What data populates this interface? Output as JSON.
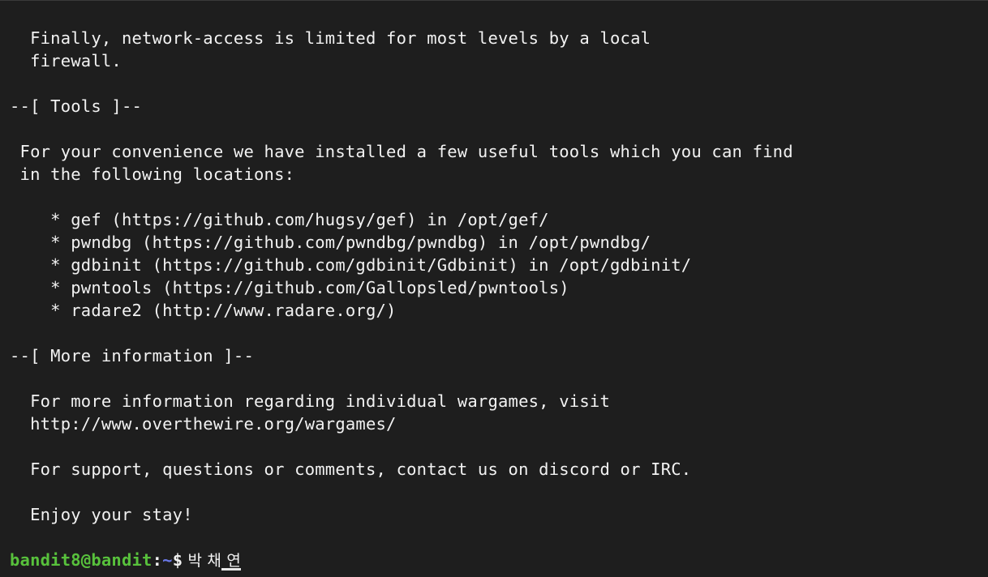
{
  "terminal": {
    "lines": [
      "  Finally, network-access is limited for most levels by a local",
      "  firewall.",
      "",
      "--[ Tools ]--",
      "",
      " For your convenience we have installed a few useful tools which you can find",
      " in the following locations:",
      "",
      "    * gef (https://github.com/hugsy/gef) in /opt/gef/",
      "    * pwndbg (https://github.com/pwndbg/pwndbg) in /opt/pwndbg/",
      "    * gdbinit (https://github.com/gdbinit/Gdbinit) in /opt/gdbinit/",
      "    * pwntools (https://github.com/Gallopsled/pwntools)",
      "    * radare2 (http://www.radare.org/)",
      "",
      "--[ More information ]--",
      "",
      "  For more information regarding individual wargames, visit",
      "  http://www.overthewire.org/wargames/",
      "",
      "  For support, questions or comments, contact us on discord or IRC.",
      "",
      "  Enjoy your stay!",
      ""
    ],
    "prompt": {
      "user_host": "bandit8@bandit",
      "colon": ":",
      "dir": "~",
      "dollar": "$",
      "input": " 박 채 연"
    },
    "colors": {
      "background": "#1e1e1e",
      "text": "#f2f2f2",
      "user_host": "#58c13c",
      "dir": "#6a78e8"
    }
  }
}
